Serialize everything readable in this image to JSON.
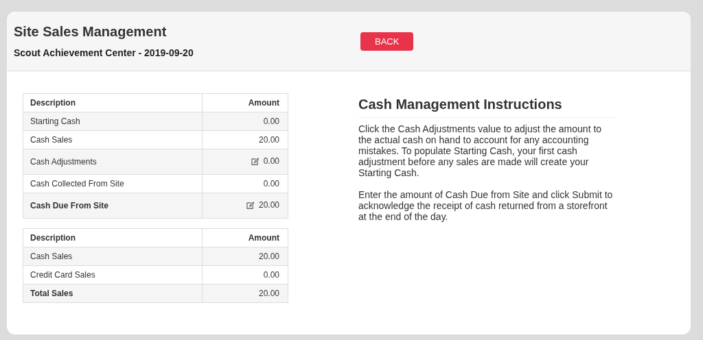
{
  "header": {
    "title": "Site Sales Management",
    "subtitle": "Scout Achievement Center - 2019-09-20",
    "back_button": "BACK"
  },
  "tables": [
    {
      "columns": [
        "Description",
        "Amount"
      ],
      "rows": [
        {
          "description": "Starting Cash",
          "amount": "0.00",
          "editable": false,
          "bold": false
        },
        {
          "description": "Cash Sales",
          "amount": "20.00",
          "editable": false,
          "bold": false
        },
        {
          "description": "Cash Adjustments",
          "amount": "0.00",
          "editable": true,
          "bold": false
        },
        {
          "description": "Cash Collected From Site",
          "amount": "0.00",
          "editable": false,
          "bold": false
        },
        {
          "description": "Cash Due From Site",
          "amount": "20.00",
          "editable": true,
          "bold": true
        }
      ]
    },
    {
      "columns": [
        "Description",
        "Amount"
      ],
      "rows": [
        {
          "description": "Cash Sales",
          "amount": "20.00",
          "editable": false,
          "bold": false
        },
        {
          "description": "Credit Card Sales",
          "amount": "0.00",
          "editable": false,
          "bold": false
        },
        {
          "description": "Total Sales",
          "amount": "20.00",
          "editable": false,
          "bold": true
        }
      ]
    }
  ],
  "instructions": {
    "title": "Cash Management Instructions",
    "paragraphs": [
      "Click the Cash Adjustments value to adjust the amount to the actual cash on hand to account for any accounting mistakes. To populate Starting Cash, your first cash adjustment before any sales are made will create your Starting Cash.",
      "Enter the amount of Cash Due from Site and click Submit to acknowledge the receipt of cash returned from a storefront at the end of the day."
    ]
  }
}
